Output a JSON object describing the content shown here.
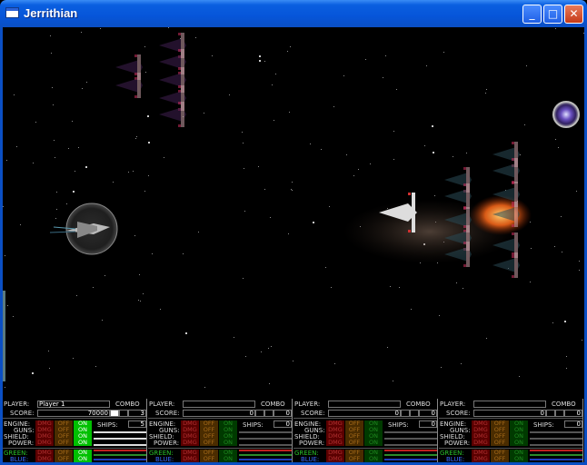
{
  "window": {
    "title": "Jerrithian",
    "min_label": "_",
    "max_label": "□",
    "close_label": "✕"
  },
  "hud": {
    "labels": {
      "player": "PLAYER:",
      "score": "SCORE:",
      "combo": "COMBO",
      "engine": "ENGINE:",
      "guns": "GUNS:",
      "shield": "SHIELD:",
      "power": "POWER:",
      "ships": "SHIPS:",
      "green": "GREEN:",
      "blue": "BLUE:",
      "dmg": "DMG",
      "off": "OFF",
      "on": "ON"
    },
    "players": [
      {
        "name": "Player 1",
        "score": "70000",
        "combo": "3",
        "ships": "5"
      },
      {
        "name": "",
        "score": "0",
        "combo": "0",
        "ships": "0"
      },
      {
        "name": "",
        "score": "0",
        "combo": "0",
        "ships": "0"
      },
      {
        "name": "",
        "score": "0",
        "combo": "0",
        "ships": "0"
      }
    ]
  },
  "colors": {
    "titlebar": "#0655d9",
    "bar_green": "#2a8a2a",
    "bar_blue": "#1f3fc0",
    "bar_red": "#c02020",
    "on_lit": "#00c000"
  }
}
